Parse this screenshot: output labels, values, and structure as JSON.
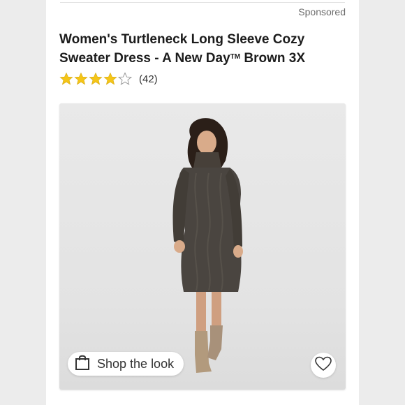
{
  "header": {
    "sponsored_label": "Sponsored"
  },
  "product": {
    "title_line1": "Women's Turtleneck Long Sleeve Cozy",
    "title_line2_pre": "Sweater Dress - A New Day",
    "trademark": "TM",
    "title_line2_post": " Brown 3X",
    "rating": 4,
    "rating_max": 5,
    "review_count": "(42)",
    "image_icon": "product-photo"
  },
  "actions": {
    "shop_the_look_label": "Shop the look",
    "shop_icon": "shopping-bag-icon",
    "favorite_icon": "heart-icon"
  },
  "colors": {
    "star_filled": "#f5c518",
    "star_outline": "#9a9a9a",
    "dress": "#4a4540"
  }
}
